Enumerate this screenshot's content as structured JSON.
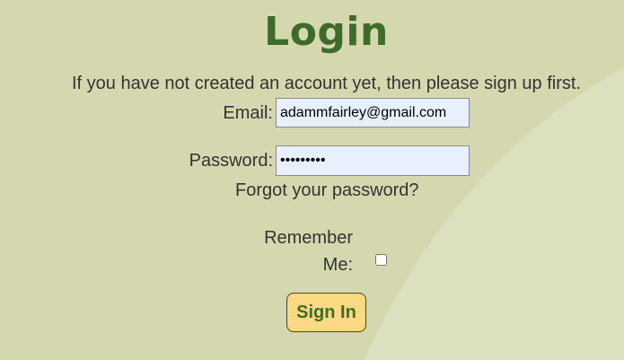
{
  "page": {
    "title": "Login",
    "intro": "If you have not created an account yet, then please sign up first."
  },
  "form": {
    "email_label": "Email:",
    "email_value": "adammfairley@gmail.com",
    "password_label": "Password:",
    "password_value": "123456789",
    "forgot_link": "Forgot your password?",
    "remember_label": "Remember Me:",
    "remember_checked": false,
    "submit_label": "Sign In"
  },
  "colors": {
    "background": "#d5d8ae",
    "background_light": "#dde0bf",
    "title": "#3f6b2a",
    "button": "#fcd982",
    "input_fill": "#e8f0fe"
  }
}
